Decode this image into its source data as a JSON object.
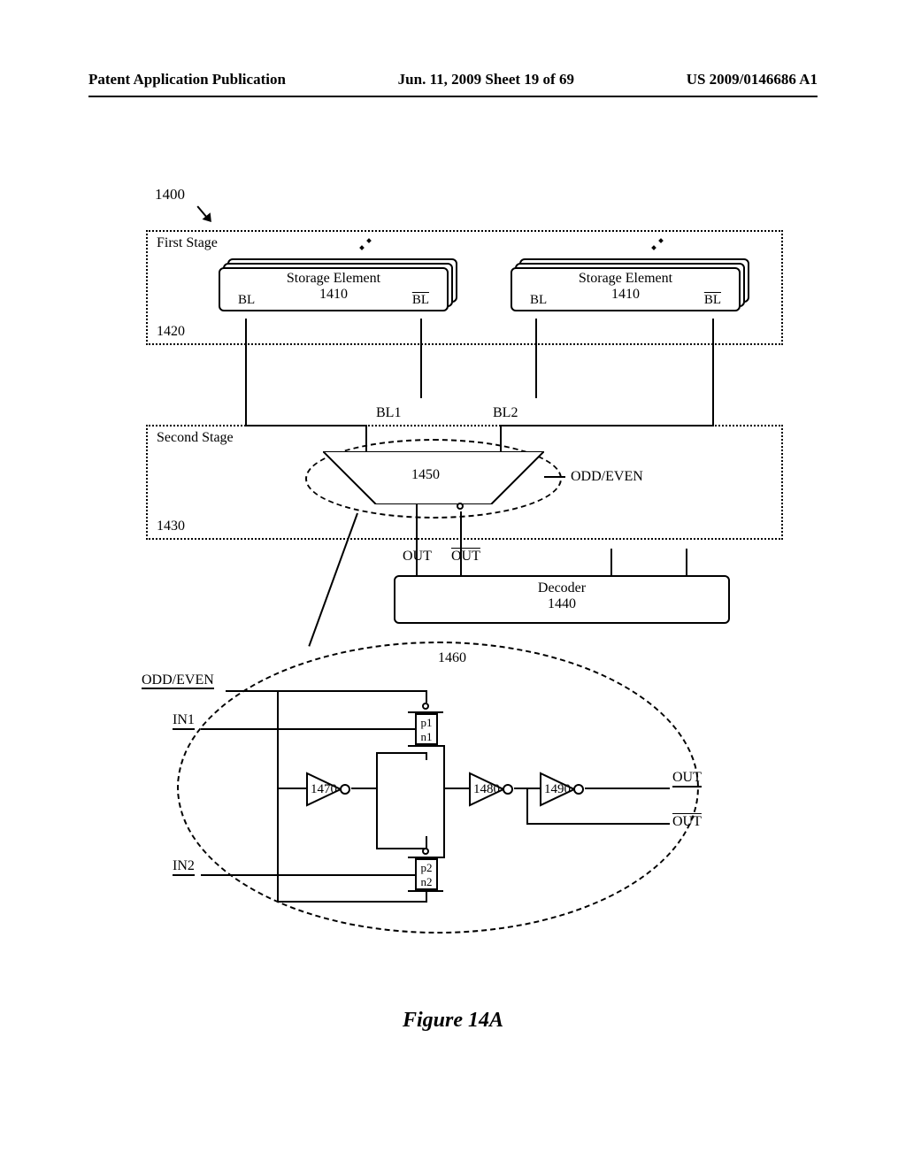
{
  "header": {
    "left": "Patent Application Publication",
    "center": "Jun. 11, 2009  Sheet 19 of 69",
    "right": "US 2009/0146686 A1"
  },
  "ref_1400": "1400",
  "first_stage": {
    "label": "First Stage",
    "ref": "1420",
    "storage": {
      "title": "Storage Element",
      "num": "1410",
      "bl": "BL",
      "bl_bar": "BL"
    }
  },
  "bl1": "BL1",
  "bl2": "BL2",
  "second_stage": {
    "label": "Second Stage",
    "ref": "1430"
  },
  "mux": {
    "ref": "1450",
    "oddeven": "ODD/EVEN"
  },
  "out": "OUT",
  "out_bar": "OUT",
  "decoder": {
    "title": "Decoder",
    "num": "1440"
  },
  "detail": {
    "ref": "1460",
    "oddeven": "ODD/EVEN",
    "in1": "IN1",
    "in2": "IN2",
    "inv1": "1470",
    "inv2": "1480",
    "inv3": "1490",
    "p1": "p1",
    "n1": "n1",
    "p2": "p2",
    "n2": "n2",
    "out": "OUT",
    "out_bar": "OUT"
  },
  "figure": "Figure 14A"
}
